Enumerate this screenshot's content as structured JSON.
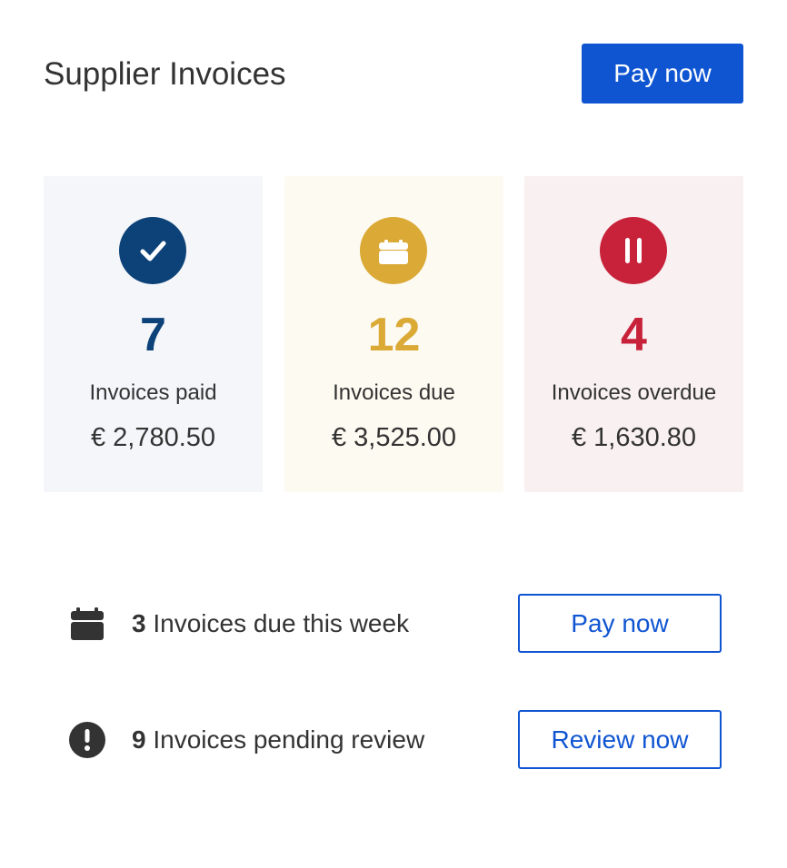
{
  "header": {
    "title": "Supplier Invoices",
    "pay_label": "Pay now"
  },
  "colors": {
    "accent": "#0f55d2",
    "paid": "#0d4278",
    "due": "#dba935",
    "overdue": "#c8223a"
  },
  "cards": [
    {
      "icon": "checkmark-icon",
      "count": "7",
      "label": "Invoices paid",
      "amount": "€ 2,780.50"
    },
    {
      "icon": "calendar-icon",
      "count": "12",
      "label": "Invoices due",
      "amount": "€ 3,525.00"
    },
    {
      "icon": "pause-icon",
      "count": "4",
      "label": "Invoices overdue",
      "amount": "€ 1,630.80"
    }
  ],
  "actions": [
    {
      "icon": "calendar-icon",
      "count": "3",
      "text": "Invoices due this week",
      "button": "Pay now"
    },
    {
      "icon": "exclamation-icon",
      "count": "9",
      "text": "Invoices pending review",
      "button": "Review now"
    }
  ]
}
